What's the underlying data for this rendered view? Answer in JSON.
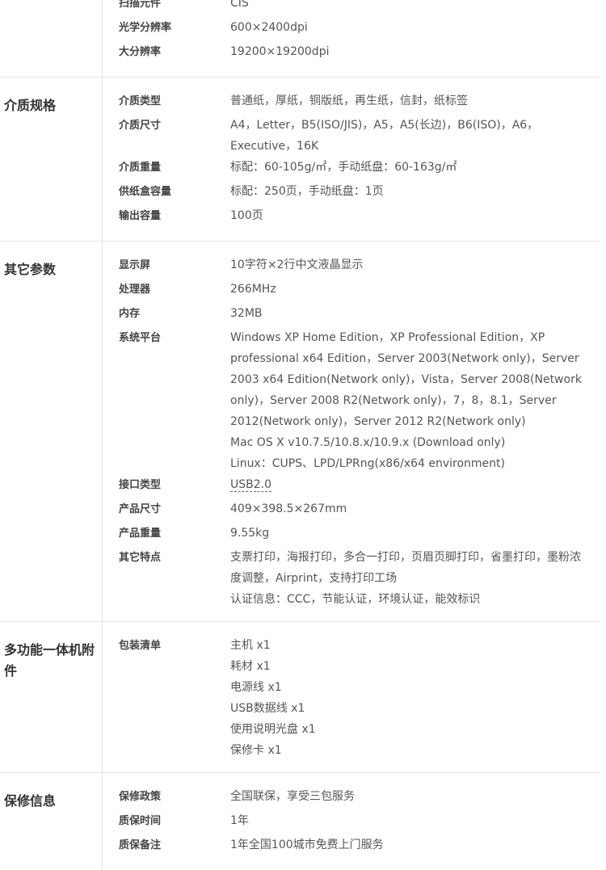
{
  "groups": [
    {
      "name": "",
      "items": [
        {
          "key": "扫描元件",
          "lines": [
            "CIS"
          ]
        },
        {
          "key": "光学分辨率",
          "lines": [
            "600×2400dpi"
          ]
        },
        {
          "key": "大分辨率",
          "lines": [
            "19200×19200dpi"
          ]
        }
      ]
    },
    {
      "name": "介质规格",
      "items": [
        {
          "key": "介质类型",
          "lines": [
            "普通纸，厚纸，铜版纸，再生纸，信封，纸标签"
          ]
        },
        {
          "key": "介质尺寸",
          "lines": [
            "A4，Letter，B5(ISO/JIS)，A5，A5(长边)，B6(ISO)，A6，Executive，16K"
          ]
        },
        {
          "key": "介质重量",
          "lines": [
            "标配：60-105g/㎡，手动纸盘：60-163g/㎡"
          ]
        },
        {
          "key": "供纸盒容量",
          "lines": [
            "标配：250页，手动纸盘：1页"
          ]
        },
        {
          "key": "输出容量",
          "lines": [
            "100页"
          ]
        }
      ]
    },
    {
      "name": "其它参数",
      "items": [
        {
          "key": "显示屏",
          "lines": [
            "10字符×2行中文液晶显示"
          ]
        },
        {
          "key": "处理器",
          "lines": [
            "266MHz"
          ]
        },
        {
          "key": "内存",
          "lines": [
            "32MB"
          ]
        },
        {
          "key": "系统平台",
          "lines": [
            "Windows XP Home Edition，XP Professional Edition，XP professional x64 Edition，Server 2003(Network only)，Server 2003 x64 Edition(Network only)，Vista，Server 2008(Network only)，Server 2008 R2(Network only)，7，8，8.1，Server 2012(Network only)，Server 2012 R2(Network only)",
            "Mac OS X v10.7.5/10.8.x/10.9.x (Download only)",
            "Linux：CUPS、LPD/LPRng(x86/x64 environment)"
          ]
        },
        {
          "key": "接口类型",
          "lines": [
            "USB2.0"
          ],
          "link": true
        },
        {
          "key": "产品尺寸",
          "lines": [
            "409×398.5×267mm"
          ]
        },
        {
          "key": "产品重量",
          "lines": [
            "9.55kg"
          ]
        },
        {
          "key": "其它特点",
          "lines": [
            "支票打印，海报打印，多合一打印，页眉页脚打印，省墨打印，墨粉浓度调整，Airprint，支持打印工场",
            "认证信息：CCC，节能认证，环境认证，能效标识"
          ]
        }
      ]
    },
    {
      "name": "多功能一体机附件",
      "items": [
        {
          "key": "包装清单",
          "lines": [
            "主机  x1",
            "耗材  x1",
            "电源线  x1",
            "USB数据线  x1",
            "使用说明光盘  x1",
            "保修卡  x1"
          ]
        }
      ]
    },
    {
      "name": "保修信息",
      "items": [
        {
          "key": "保修政策",
          "lines": [
            "全国联保，享受三包服务"
          ]
        },
        {
          "key": "质保时间",
          "lines": [
            "1年"
          ]
        },
        {
          "key": "质保备注",
          "lines": [
            "1年全国100城市免费上门服务"
          ]
        }
      ]
    }
  ]
}
